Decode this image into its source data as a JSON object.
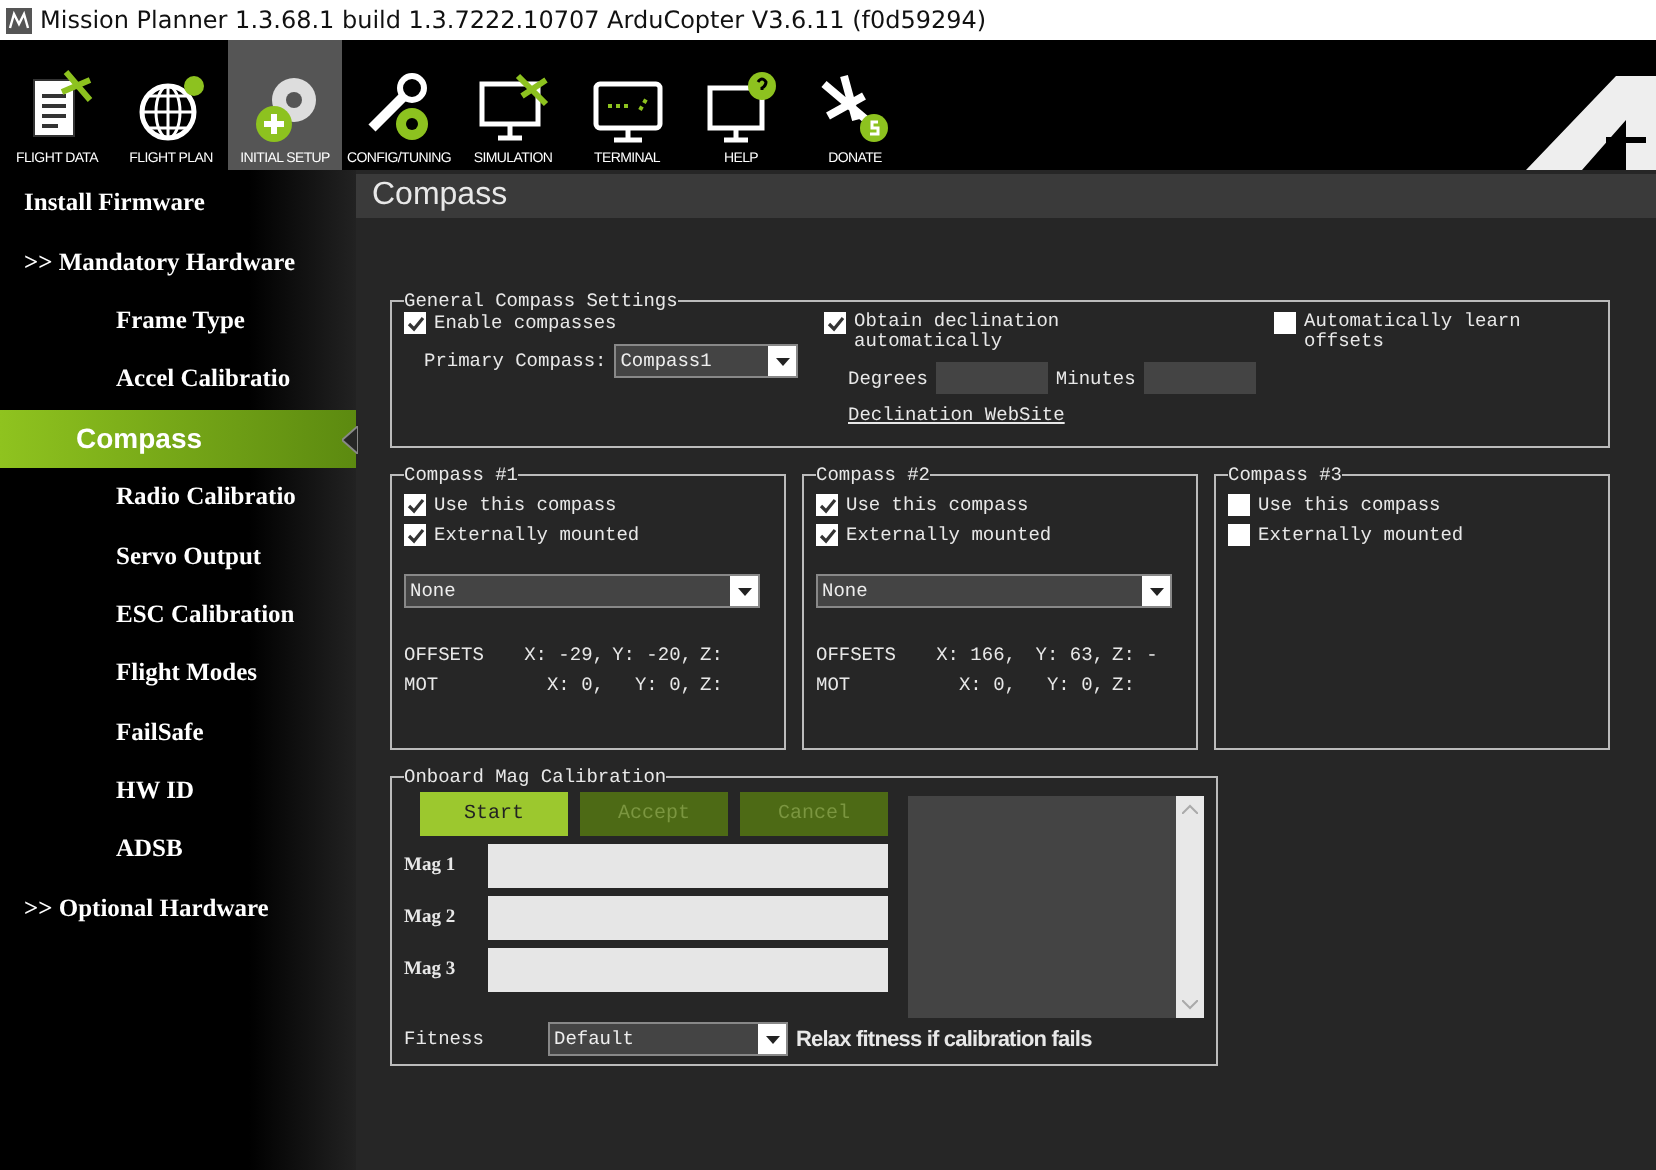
{
  "window": {
    "title": "Mission Planner 1.3.68.1 build 1.3.7222.10707 ArduCopter V3.6.11 (f0d59294)"
  },
  "toolbar": [
    {
      "label": "FLIGHT DATA",
      "selected": false
    },
    {
      "label": "FLIGHT PLAN",
      "selected": false
    },
    {
      "label": "INITIAL SETUP",
      "selected": true
    },
    {
      "label": "CONFIG/TUNING",
      "selected": false
    },
    {
      "label": "SIMULATION",
      "selected": false
    },
    {
      "label": "TERMINAL",
      "selected": false
    },
    {
      "label": "HELP",
      "selected": false
    },
    {
      "label": "DONATE",
      "selected": false
    }
  ],
  "sidebar": {
    "items": [
      {
        "label": "Install Firmware",
        "kind": "group",
        "selected": false
      },
      {
        "label": ">> Mandatory Hardware",
        "kind": "group",
        "selected": false
      },
      {
        "label": "Frame Type",
        "kind": "item",
        "selected": false
      },
      {
        "label": "Accel Calibratio",
        "kind": "item",
        "selected": false
      },
      {
        "label": "Compass",
        "kind": "item",
        "selected": true
      },
      {
        "label": "Radio Calibratio",
        "kind": "item",
        "selected": false
      },
      {
        "label": "Servo Output",
        "kind": "item",
        "selected": false
      },
      {
        "label": "ESC Calibration",
        "kind": "item",
        "selected": false
      },
      {
        "label": "Flight Modes",
        "kind": "item",
        "selected": false
      },
      {
        "label": "FailSafe",
        "kind": "item",
        "selected": false
      },
      {
        "label": "HW ID",
        "kind": "item",
        "selected": false
      },
      {
        "label": "ADSB",
        "kind": "item",
        "selected": false
      },
      {
        "label": ">> Optional Hardware",
        "kind": "group",
        "selected": false
      }
    ]
  },
  "page_title": "Compass",
  "general": {
    "legend": "General Compass Settings",
    "enable": {
      "label": "Enable compasses",
      "checked": true
    },
    "primary_label": "Primary Compass:",
    "primary_value": "Compass1",
    "obtain": {
      "label": "Obtain declination automatically",
      "checked": true
    },
    "degrees_label": "Degrees",
    "minutes_label": "Minutes",
    "link": "Declination WebSite",
    "auto_learn": {
      "label": "Automatically learn offsets",
      "checked": false
    }
  },
  "compasses": [
    {
      "legend": "Compass #1",
      "use": {
        "label": "Use this compass",
        "checked": true
      },
      "external": {
        "label": "Externally mounted",
        "checked": true
      },
      "orientation": "None",
      "rows": [
        {
          "label": "OFFSETS",
          "values": [
            "X: -29,",
            "Y: -20,",
            "Z:"
          ]
        },
        {
          "label": "MOT",
          "values": [
            "X: 0,",
            "Y: 0,",
            "Z:"
          ]
        }
      ]
    },
    {
      "legend": "Compass #2",
      "use": {
        "label": "Use this compass",
        "checked": true
      },
      "external": {
        "label": "Externally mounted",
        "checked": true
      },
      "orientation": "None",
      "rows": [
        {
          "label": "OFFSETS",
          "values": [
            "X: 166,",
            "Y: 63,",
            "Z: -"
          ]
        },
        {
          "label": "MOT",
          "values": [
            "X: 0,",
            "Y: 0,",
            "Z:"
          ]
        }
      ]
    },
    {
      "legend": "Compass #3",
      "use": {
        "label": "Use this compass",
        "checked": false
      },
      "external": {
        "label": "Externally mounted",
        "checked": false
      }
    }
  ],
  "onboard": {
    "legend": "Onboard Mag Calibration",
    "buttons": [
      {
        "label": "Start",
        "disabled": false
      },
      {
        "label": "Accept",
        "disabled": true
      },
      {
        "label": "Cancel",
        "disabled": true
      }
    ],
    "mags": [
      "Mag 1",
      "Mag 2",
      "Mag 3"
    ],
    "fitness_label": "Fitness",
    "fitness_value": "Default",
    "relax": "Relax fitness if calibration fails"
  }
}
